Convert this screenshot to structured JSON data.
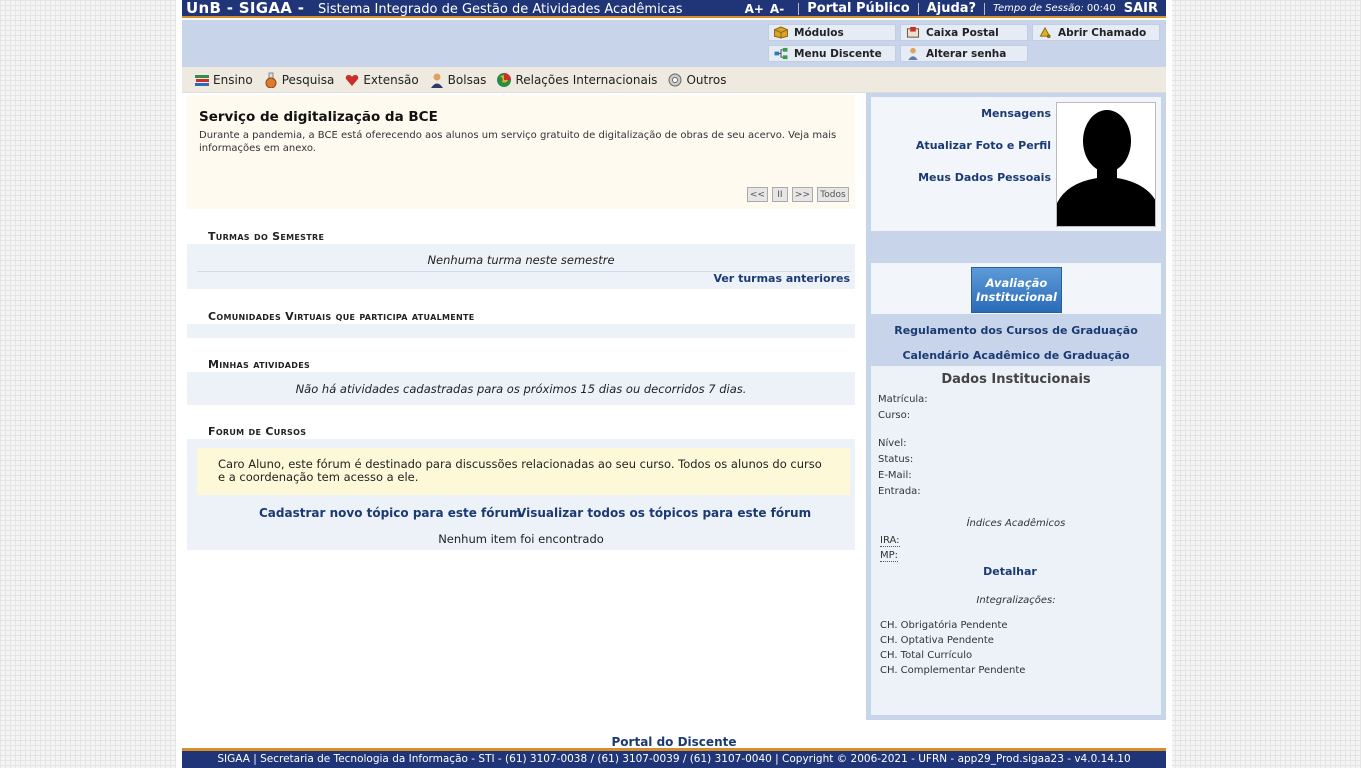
{
  "header": {
    "brand": "UnB - SIGAA -",
    "subtitle": "Sistema Integrado de Gestão de Atividades Acadêmicas",
    "font_increase": "A+",
    "font_decrease": "A-",
    "portal_publico": "Portal Público",
    "ajuda": "Ajuda?",
    "session_label": "Tempo de Sessão:",
    "session_time": "00:40",
    "sair": "SAIR"
  },
  "modules": {
    "modulos": "Módulos",
    "caixa_postal": "Caixa Postal",
    "abrir_chamado": "Abrir Chamado",
    "menu_discente": "Menu Discente",
    "alterar_senha": "Alterar senha"
  },
  "menu": [
    {
      "label": "Ensino",
      "icon": "books-icon"
    },
    {
      "label": "Pesquisa",
      "icon": "flask-icon"
    },
    {
      "label": "Extensão",
      "icon": "heart-icon"
    },
    {
      "label": "Bolsas",
      "icon": "person-icon"
    },
    {
      "label": "Relações Internacionais",
      "icon": "globe-icon"
    },
    {
      "label": "Outros",
      "icon": "gears-icon"
    }
  ],
  "notice": {
    "title": "Serviço de digitalização da BCE",
    "body": "Durante a pandemia, a BCE está oferecendo aos alunos um serviço gratuito de digitalização de obras de seu acervo. Veja mais informações em anexo.",
    "prev": "<<",
    "pause": "II",
    "next": ">>",
    "all": "Todos"
  },
  "turmas": {
    "title": "Turmas do Semestre",
    "empty": "Nenhuma turma neste semestre",
    "ver_anteriores": "Ver turmas anteriores"
  },
  "comunidades": {
    "title": "Comunidades Virtuais que participa atualmente"
  },
  "atividades": {
    "title": "Minhas atividades",
    "empty": "Não há atividades cadastradas para os próximos 15 dias ou decorridos 7 dias."
  },
  "forum": {
    "title": "Forum de Cursos",
    "message": "Caro Aluno, este fórum é destinado para discussões relacionadas ao seu curso. Todos os alunos do curso e a coordenação tem acesso a ele.",
    "cadastrar": "Cadastrar novo tópico para este fórum",
    "visualizar": "Visualizar todos os tópicos para este fórum",
    "empty": "Nenhum item foi encontrado"
  },
  "profile": {
    "mensagens": "Mensagens",
    "atualizar_foto": "Atualizar Foto e Perfil",
    "meus_dados": "Meus Dados Pessoais"
  },
  "institucional": {
    "avaliacao_line1": "Avaliação",
    "avaliacao_line2": "Institucional",
    "regulamento": "Regulamento dos Cursos de Graduação",
    "calendario": "Calendário Acadêmico de Graduação"
  },
  "dados": {
    "title": "Dados Institucionais",
    "matricula": "Matrícula:",
    "curso": "Curso:",
    "nivel": "Nível:",
    "status": "Status:",
    "email": "E-Mail:",
    "entrada": "Entrada:",
    "indices_title": "Índices Acadêmicos",
    "ira": "IRA:",
    "mp": "MP:",
    "detalhar": "Detalhar",
    "integralizacoes_title": "Integralizações:",
    "ch_obrigatoria": "CH. Obrigatória Pendente",
    "ch_optativa": "CH. Optativa Pendente",
    "ch_total": "CH. Total Currículo",
    "ch_complementar": "CH. Complementar Pendente"
  },
  "footer": {
    "portal_discente": "Portal do Discente",
    "text": "SIGAA | Secretaria de Tecnologia da Informação - STI - (61) 3107-0038 / (61) 3107-0039 / (61) 3107-0040 | Copyright © 2006-2021 - UFRN - app29_Prod.sigaa23 - v4.0.14.10"
  },
  "colors": {
    "header_blue": "#1f3577",
    "accent_orange": "#d98e2a",
    "module_bg": "#c7d4ea",
    "link_blue": "#1b3a74"
  }
}
